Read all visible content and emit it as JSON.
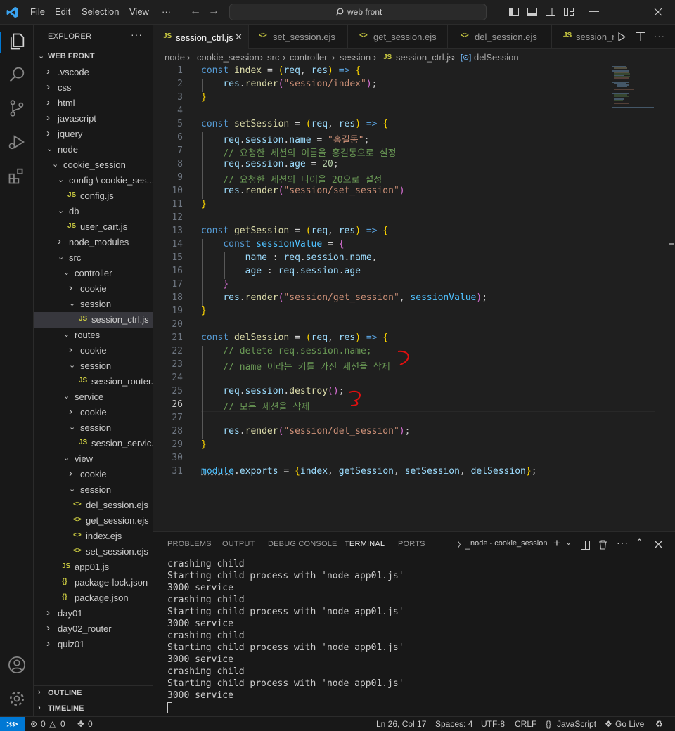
{
  "menu": {
    "file": "File",
    "edit": "Edit",
    "selection": "Selection",
    "view": "View",
    "more": "···"
  },
  "search": {
    "text": "web front"
  },
  "explorer": {
    "title": "EXPLORER",
    "more": "···",
    "root": "WEB FRONT",
    "items": [
      {
        "label": ".vscode"
      },
      {
        "label": "css"
      },
      {
        "label": "html"
      },
      {
        "label": "javascript"
      },
      {
        "label": "jquery"
      },
      {
        "label": "node"
      },
      {
        "label": "cookie_session"
      },
      {
        "label": "config \\ cookie_ses..."
      },
      {
        "label": "config.js",
        "icon": "JS"
      },
      {
        "label": "db"
      },
      {
        "label": "user_cart.js",
        "icon": "JS"
      },
      {
        "label": "node_modules"
      },
      {
        "label": "src"
      },
      {
        "label": "controller"
      },
      {
        "label": "cookie"
      },
      {
        "label": "session"
      },
      {
        "label": "session_ctrl.js",
        "icon": "JS"
      },
      {
        "label": "routes"
      },
      {
        "label": "cookie"
      },
      {
        "label": "session"
      },
      {
        "label": "session_router.js",
        "icon": "JS"
      },
      {
        "label": "service"
      },
      {
        "label": "cookie"
      },
      {
        "label": "session"
      },
      {
        "label": "session_servic...",
        "icon": "JS"
      },
      {
        "label": "view"
      },
      {
        "label": "cookie"
      },
      {
        "label": "session"
      },
      {
        "label": "del_session.ejs",
        "icon": "<>"
      },
      {
        "label": "get_session.ejs",
        "icon": "<>"
      },
      {
        "label": "index.ejs",
        "icon": "<>"
      },
      {
        "label": "set_session.ejs",
        "icon": "<>"
      },
      {
        "label": "app01.js",
        "icon": "JS"
      },
      {
        "label": "package-lock.json",
        "icon": "{}"
      },
      {
        "label": "package.json",
        "icon": "{}"
      },
      {
        "label": "day01"
      },
      {
        "label": "day02_router"
      },
      {
        "label": "quiz01"
      }
    ],
    "outline": "OUTLINE",
    "timeline": "TIMELINE"
  },
  "tabs": [
    {
      "label": "session_ctrl.js",
      "icon": "JS"
    },
    {
      "label": "set_session.ejs",
      "icon": "<>"
    },
    {
      "label": "get_session.ejs",
      "icon": "<>"
    },
    {
      "label": "del_session.ejs",
      "icon": "<>"
    },
    {
      "label": "session_r",
      "icon": "JS"
    }
  ],
  "breadcrumb": [
    "node",
    "cookie_session",
    "src",
    "controller",
    "session",
    "session_ctrl.js",
    "delSession"
  ],
  "code_lines": [
    "1",
    "2",
    "3",
    "4",
    "5",
    "6",
    "7",
    "8",
    "9",
    "10",
    "11",
    "12",
    "13",
    "14",
    "15",
    "16",
    "17",
    "18",
    "19",
    "20",
    "21",
    "22",
    "23",
    "24",
    "25",
    "26",
    "27",
    "28",
    "29",
    "30",
    "31"
  ],
  "code_text": {
    "l6_str": "\"홍길동\"",
    "l7": "// 요청한 세션의 이름을 홍길동으로 설정",
    "l9": "// 요청한 세션의 나이을 20으로 설정",
    "l22": "// delete req.session.name;",
    "l23": "// name 이라는 키를 가진 세션을 삭제",
    "l26": "// 모든 세션을 삭제"
  },
  "panel": {
    "tabs": [
      "PROBLEMS",
      "OUTPUT",
      "DEBUG CONSOLE",
      "TERMINAL",
      "PORTS"
    ],
    "terminal_name": "node - cookie_session",
    "lines": [
      "crashing child",
      "Starting child process with 'node app01.js'",
      "3000 service",
      "crashing child",
      "Starting child process with 'node app01.js'",
      "3000 service",
      "crashing child",
      "Starting child process with 'node app01.js'",
      "3000 service",
      "crashing child",
      "Starting child process with 'node app01.js'",
      "3000 service"
    ]
  },
  "status": {
    "errors": "0",
    "warnings": "0",
    "ports": "0",
    "position": "Ln 26, Col 17",
    "spaces": "Spaces: 4",
    "encoding": "UTF-8",
    "eol": "CRLF",
    "language": "JavaScript",
    "golive": "Go Live"
  },
  "colors": {
    "accent": "#0078d4",
    "background": "#1f1f1f",
    "sidebar": "#181818"
  }
}
